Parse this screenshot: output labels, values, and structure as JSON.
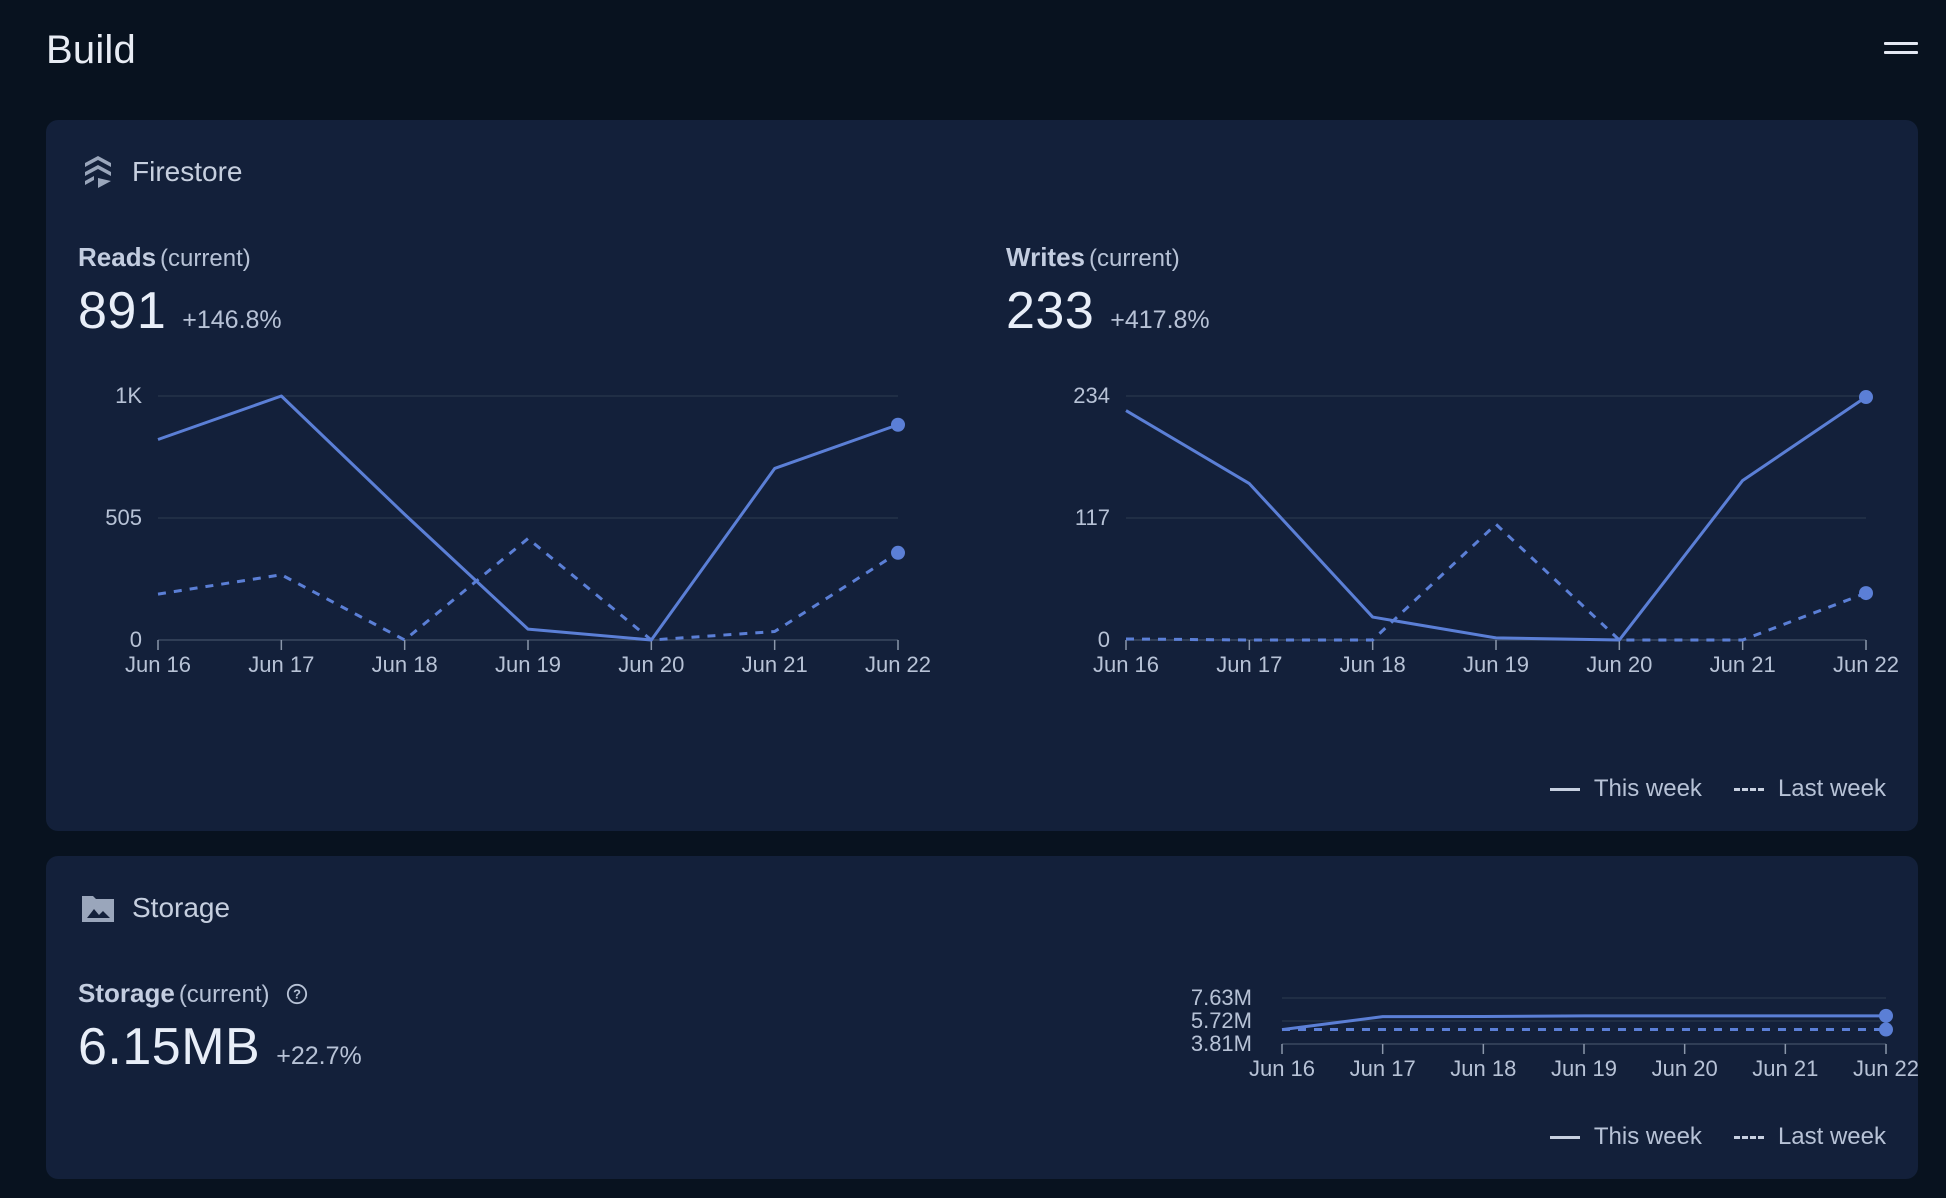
{
  "page": {
    "title": "Build"
  },
  "colors": {
    "background": "#08121f",
    "card": "#13203a",
    "series": "#5b7fd6",
    "grid": "#243249",
    "text_muted": "#b7c2d6"
  },
  "firestore": {
    "title": "Firestore",
    "icon": "firestore-icon",
    "reads": {
      "label": "Reads",
      "sublabel": "(current)",
      "value": "891",
      "delta": "+146.8%"
    },
    "writes": {
      "label": "Writes",
      "sublabel": "(current)",
      "value": "233",
      "delta": "+417.8%"
    },
    "legend": {
      "this_week": "This week",
      "last_week": "Last week"
    }
  },
  "storage": {
    "title": "Storage",
    "icon": "folder-image-icon",
    "metric": {
      "label": "Storage",
      "sublabel": "(current)",
      "value": "6.15MB",
      "delta": "+22.7%"
    },
    "legend": {
      "this_week": "This week",
      "last_week": "Last week"
    }
  },
  "chart_data": [
    {
      "id": "reads",
      "type": "line",
      "categories": [
        "Jun 16",
        "Jun 17",
        "Jun 18",
        "Jun 19",
        "Jun 20",
        "Jun 21",
        "Jun 22"
      ],
      "y_ticks": [
        "0",
        "505",
        "1K"
      ],
      "ylim": [
        0,
        1010
      ],
      "grid": true,
      "legend": "bottom-right",
      "series": [
        {
          "name": "This week",
          "style": "solid",
          "values": [
            830,
            1010,
            520,
            45,
            0,
            710,
            891
          ]
        },
        {
          "name": "Last week",
          "style": "dashed",
          "values": [
            190,
            270,
            0,
            420,
            0,
            35,
            361
          ]
        }
      ]
    },
    {
      "id": "writes",
      "type": "line",
      "categories": [
        "Jun 16",
        "Jun 17",
        "Jun 18",
        "Jun 19",
        "Jun 20",
        "Jun 21",
        "Jun 22"
      ],
      "y_ticks": [
        "0",
        "117",
        "234"
      ],
      "ylim": [
        0,
        234
      ],
      "grid": true,
      "legend": "bottom-right",
      "series": [
        {
          "name": "This week",
          "style": "solid",
          "values": [
            220,
            150,
            22,
            2,
            0,
            153,
            233
          ]
        },
        {
          "name": "Last week",
          "style": "dashed",
          "values": [
            1,
            0,
            0,
            111,
            0,
            0,
            45
          ]
        }
      ]
    },
    {
      "id": "storage",
      "type": "line",
      "categories": [
        "Jun 16",
        "Jun 17",
        "Jun 18",
        "Jun 19",
        "Jun 20",
        "Jun 21",
        "Jun 22"
      ],
      "y_ticks": [
        "3.81M",
        "5.72M",
        "7.63M"
      ],
      "ylim": [
        3.81,
        7.63
      ],
      "grid": true,
      "legend": "bottom-right",
      "series": [
        {
          "name": "This week",
          "style": "solid",
          "values": [
            5.0,
            6.08,
            6.09,
            6.15,
            6.15,
            6.15,
            6.15
          ]
        },
        {
          "name": "Last week",
          "style": "dashed",
          "values": [
            5.01,
            5.01,
            5.01,
            5.01,
            5.01,
            5.01,
            5.01
          ]
        }
      ]
    }
  ]
}
